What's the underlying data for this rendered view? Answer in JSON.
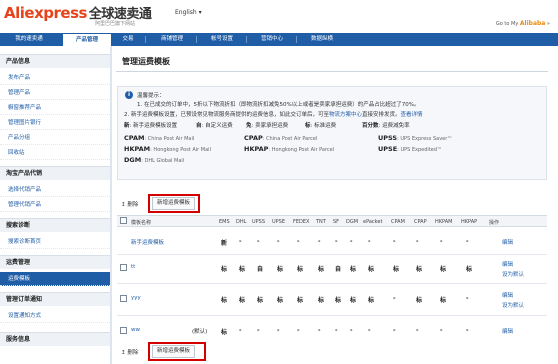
{
  "header": {
    "logo_ali": "Ali",
    "logo_express": "express",
    "logo_cn": "全球速卖通",
    "logo_sub": "阿里巴巴旗下网站",
    "language": "English ▾",
    "goto_prefix": "Go to My ",
    "goto_brand": "Alibaba",
    "goto_suffix": " »"
  },
  "nav": {
    "items": [
      {
        "label": "我的速卖通"
      },
      {
        "label": "产品管理"
      },
      {
        "label": "交易"
      },
      {
        "label": "商铺管理"
      },
      {
        "label": "帐号设置"
      },
      {
        "label": "营销中心"
      },
      {
        "label": "数据纵横"
      }
    ],
    "active_index": 1
  },
  "sidebar": {
    "sections": [
      {
        "title": "产品信息",
        "items": [
          "发布产品",
          "管理产品",
          "橱窗推荐产品",
          "管理图片银行",
          "产品分组",
          "回收站"
        ]
      },
      {
        "title": "淘宝产品代销",
        "items": [
          "选择代销产品",
          "管理代销产品"
        ]
      },
      {
        "title": "搜索诊断",
        "items": [
          "搜索诊断首页"
        ]
      },
      {
        "title": "运费管理",
        "items": [
          "运费模板"
        ]
      },
      {
        "title": "管理订单通知",
        "items": [
          "设置通知方式"
        ]
      },
      {
        "title": "服务信息",
        "items": []
      }
    ],
    "active_item": "运费模板"
  },
  "main": {
    "title": "管理运费模板",
    "tips": {
      "heading": "温馨提示：",
      "line1": "1. 在已成交的订单中，5折以下物流折扣（即物流折扣减免50%以上或者是卖家承担运费）的产品占比超过了70%。",
      "line2a": "2. 新手运费模板设置",
      "line2b": "，已预设常见物流服务商提供的运费信息，如此交订单后，可至",
      "line2c": "物流方案中心",
      "line2d": "直接安排发货。",
      "line2e": "查看详情",
      "legend": [
        {
          "key": "新",
          "text": ": 新手运费模板设置"
        },
        {
          "key": "自",
          "text": ": 自定义运费"
        },
        {
          "key": "免",
          "text": ": 卖家承担运费"
        },
        {
          "key": "标",
          "text": ": 标准运费"
        },
        {
          "key": "百分数",
          "text": ": 运费减免率"
        }
      ],
      "codes": [
        {
          "code": "CPAM",
          "desc": ": China Post Air Mail"
        },
        {
          "code": "CPAP",
          "desc": ": China Post Air Parcel"
        },
        {
          "code": "UPSS",
          "desc": ": UPS Express Saver™"
        },
        {
          "code": "HKPAM",
          "desc": ": Hongkong Post Air Mail"
        },
        {
          "code": "HKPAP",
          "desc": ": Hongkong Post Air Parcel"
        },
        {
          "code": "UPSE",
          "desc": ": UPS Expedited™"
        },
        {
          "code": "DGM",
          "desc": ": DHL Global Mail"
        }
      ]
    },
    "actions": {
      "delete": "删除",
      "new_template": "新增运费模板"
    },
    "table": {
      "headers": [
        "模板名称",
        "EMS",
        "DHL",
        "UPSS",
        "UPSE",
        "FEDEX",
        "TNT",
        "SF",
        "DGM",
        "ePacket",
        "CPAM",
        "CPAP",
        "HKPAM",
        "HKPAP",
        "操作"
      ],
      "rows": [
        {
          "name": "新手运费模板",
          "extra": "",
          "cells": [
            "新",
            "-",
            "-",
            "-",
            "-",
            "-",
            "-",
            "-",
            "-",
            "-",
            "-",
            "-",
            "-"
          ],
          "links": [
            "编辑"
          ]
        },
        {
          "name": "tt",
          "extra": "",
          "cells": [
            "标",
            "标",
            "自",
            "标",
            "标",
            "标",
            "自",
            "标",
            "标",
            "标",
            "标",
            "标",
            "标"
          ],
          "links": [
            "编辑",
            "设为默认"
          ]
        },
        {
          "name": "yyy",
          "extra": "",
          "cells": [
            "标",
            "标",
            "标",
            "标",
            "标",
            "标",
            "标",
            "标",
            "标",
            "-",
            "标",
            "标",
            "-"
          ],
          "links": [
            "编辑",
            "设为默认"
          ]
        },
        {
          "name": "ww",
          "extra": "(默认)",
          "cells": [
            "标",
            "-",
            "-",
            "-",
            "-",
            "-",
            "-",
            "-",
            "-",
            "-",
            "-",
            "-",
            "-"
          ],
          "links": [
            "编辑"
          ]
        }
      ]
    }
  }
}
